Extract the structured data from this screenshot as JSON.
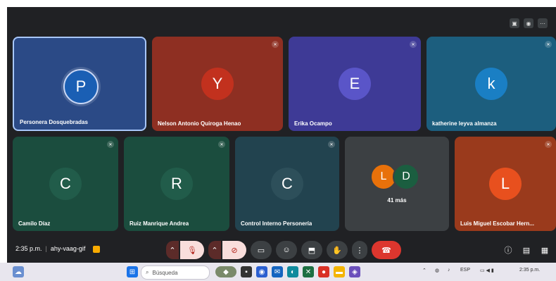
{
  "participants": [
    {
      "name": "Personera Dosquebradas",
      "initial": "P",
      "tile_color": "#2b4a86",
      "avatar_color": "#1a5fb4"
    },
    {
      "name": "Nelson Antonio Quiroga Henao",
      "initial": "Y",
      "tile_color": "#8e2f22",
      "avatar_color": "#c2311e"
    },
    {
      "name": "Erika Ocampo",
      "initial": "E",
      "tile_color": "#3e3a96",
      "avatar_color": "#5a55c8"
    },
    {
      "name": "katherine leyva almanza",
      "initial": "k",
      "tile_color": "#1c5e7e",
      "avatar_color": "#1a7fc4"
    },
    {
      "name": "Camilo Díaz",
      "initial": "C",
      "tile_color": "#1b4d3e",
      "avatar_color": "#215c4a"
    },
    {
      "name": "Ruiz Manrique Andrea",
      "initial": "R",
      "tile_color": "#1b4d3e",
      "avatar_color": "#215c4a"
    },
    {
      "name": "Control Interno Personería",
      "initial": "C",
      "tile_color": "#22434f",
      "avatar_color": "#2d4f5a"
    },
    {
      "name": "Luis Miguel Escobar Hern...",
      "initial": "L",
      "tile_color": "#9a3a1c",
      "avatar_color": "#e8501e"
    }
  ],
  "others": {
    "initials": [
      "L",
      "D"
    ],
    "label": "41 más",
    "colors": [
      "#e8710a",
      "#1b5e40"
    ]
  },
  "meeting": {
    "time": "2:35 p.m.",
    "code": "ahy-vaag-gif"
  },
  "taskbar": {
    "search_placeholder": "Búsqueda",
    "lang": "ESP",
    "time": "2:35 p.m."
  }
}
